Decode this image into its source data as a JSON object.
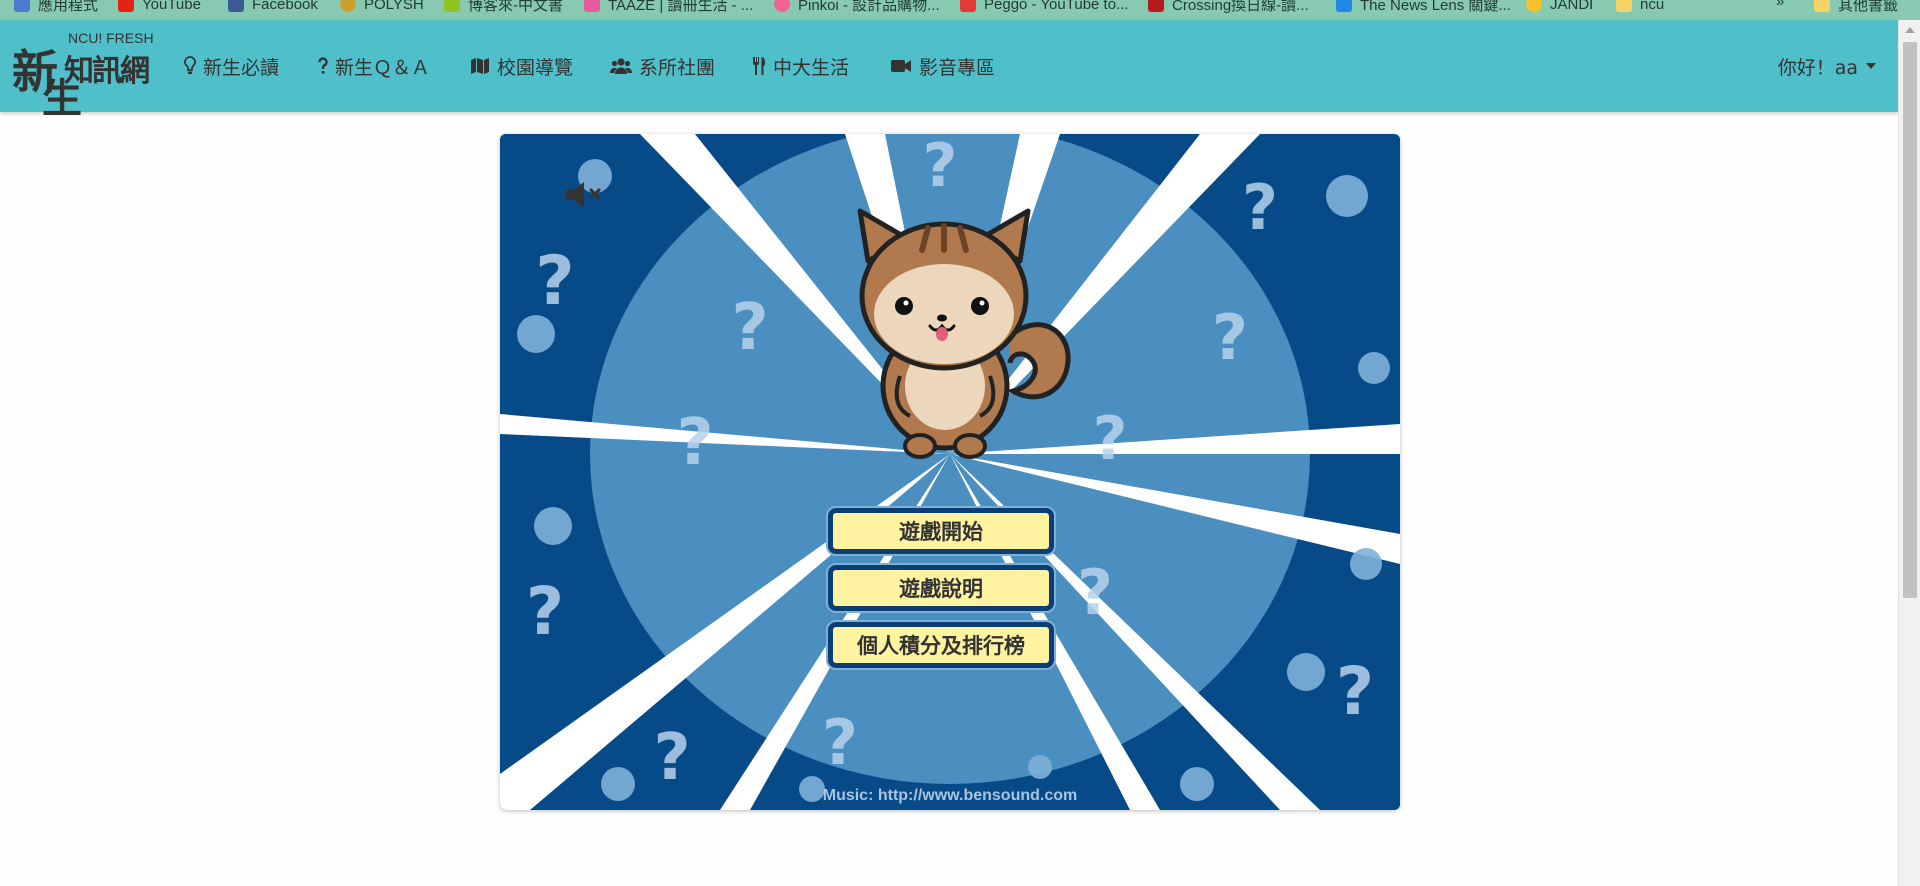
{
  "bookmarks": [
    {
      "label": "應用程式",
      "color": "#4a7bd0"
    },
    {
      "label": "YouTube",
      "color": "#e62117"
    },
    {
      "label": "Facebook",
      "color": "#3b5998"
    },
    {
      "label": "POLYSH",
      "color": "#c9a02c"
    },
    {
      "label": "博客來-中文書",
      "color": "#8fc31f"
    },
    {
      "label": "TAAZE | 讀冊生活 - ...",
      "color": "#e85c9d"
    },
    {
      "label": "Pinkoi - 設計品購物...",
      "color": "#f06292"
    },
    {
      "label": "Peggo - YouTube to...",
      "color": "#e53935"
    },
    {
      "label": "Crossing換日線-讀...",
      "color": "#b71c1c"
    },
    {
      "label": "The News Lens 關鍵...",
      "color": "#1e88e5"
    },
    {
      "label": "JANDI",
      "color": "#fbc02d"
    },
    {
      "label": "ncu",
      "color": "#f6d365"
    }
  ],
  "bookmarks_more": "»",
  "bookmarks_other": "其他書籤",
  "logo": {
    "small": "NCU! FRESH",
    "line1": "新",
    "line2": "知訊網",
    "line3": "生"
  },
  "nav": [
    {
      "label": "新生必讀",
      "icon": "lightbulb-icon"
    },
    {
      "label": "新生Ｑ＆Ａ",
      "icon": "question-icon"
    },
    {
      "label": "校園導覽",
      "icon": "map-icon"
    },
    {
      "label": "系所社團",
      "icon": "users-icon"
    },
    {
      "label": "中大生活",
      "icon": "cutlery-icon"
    },
    {
      "label": "影音專區",
      "icon": "video-icon"
    }
  ],
  "user": {
    "greeting": "你好！aa"
  },
  "game": {
    "buttons": [
      "遊戲開始",
      "遊戲說明",
      "個人積分及排行榜"
    ],
    "credit": "Music: http://www.bensound.com",
    "mute_icon": "speaker-muted-icon",
    "colors": {
      "dark": "#064b87",
      "light": "#4a8fc0",
      "ray": "#ffffff",
      "button": "#fdf3a0",
      "nav": "#4fbfca"
    }
  }
}
